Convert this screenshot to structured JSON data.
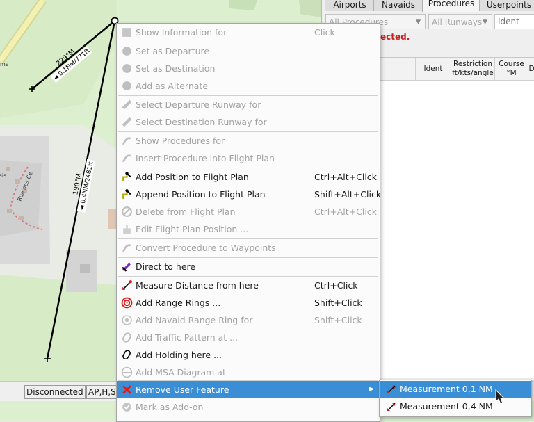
{
  "map": {
    "leg1": {
      "bearing": "229°M",
      "distance": "◄ 0.1NM/771ft"
    },
    "leg2": {
      "bearing": "190°M",
      "distance": "◄ 0.4NM/2481ft"
    },
    "street_label": "Rue des Ce",
    "partial_labels": [
      "ms",
      "ais"
    ]
  },
  "dock": {
    "tabs": [
      "Airports",
      "Navaids",
      "Procedures",
      "Userpoints"
    ],
    "active_tab": "Procedures",
    "filters": {
      "procedures": "All Procedures",
      "runways": "All Runways",
      "ident_placeholder": "Ident"
    },
    "error": "ected.",
    "columns": [
      "tion",
      "Ident",
      "Restriction ft/kts/angle",
      "Course °M",
      "D"
    ]
  },
  "status_bar": {
    "connection": "Disconnected",
    "flags": "AP,H,S,"
  },
  "context_menu": {
    "items": [
      {
        "label": "Show Information for",
        "shortcut": "Click",
        "enabled": false,
        "icon": "info-icon"
      },
      {
        "label": "Set  as Departure",
        "shortcut": "",
        "enabled": false,
        "icon": "airport-icon"
      },
      {
        "label": "Set  as Destination",
        "shortcut": "",
        "enabled": false,
        "icon": "airport-icon"
      },
      {
        "label": "Add  as Alternate",
        "shortcut": "",
        "enabled": false,
        "icon": "airport-icon"
      },
      {
        "label": "Select Departure Runway for",
        "shortcut": "",
        "enabled": false,
        "icon": "runway-icon"
      },
      {
        "label": "Select Destination Runway for",
        "shortcut": "",
        "enabled": false,
        "icon": "runway-icon"
      },
      {
        "label": "Show Procedures for",
        "shortcut": "",
        "enabled": false,
        "icon": "procedure-icon"
      },
      {
        "label": "Insert Procedure  into Flight Plan",
        "shortcut": "",
        "enabled": false,
        "icon": "procedure-icon"
      },
      {
        "label": "Add Position to Flight Plan",
        "shortcut": "Ctrl+Alt+Click",
        "enabled": true,
        "icon": "add-position-icon"
      },
      {
        "label": "Append Position to Flight Plan",
        "shortcut": "Shift+Alt+Click",
        "enabled": true,
        "icon": "append-position-icon"
      },
      {
        "label": "Delete  from Flight Plan",
        "shortcut": "Ctrl+Alt+Click",
        "enabled": false,
        "icon": "delete-icon"
      },
      {
        "label": "Edit Flight Plan Position ...",
        "shortcut": "",
        "enabled": false,
        "icon": "edit-icon"
      },
      {
        "label": "Convert Procedure to Waypoints",
        "shortcut": "",
        "enabled": false,
        "icon": "procedure-icon"
      },
      {
        "label": "Direct to here",
        "shortcut": "",
        "enabled": true,
        "icon": "direct-to-icon"
      },
      {
        "label": "Measure Distance from here",
        "shortcut": "Ctrl+Click",
        "enabled": true,
        "icon": "measure-icon"
      },
      {
        "label": "Add Range Rings ...",
        "shortcut": "Shift+Click",
        "enabled": true,
        "icon": "range-rings-icon"
      },
      {
        "label": "Add Navaid Range Ring for",
        "shortcut": "Shift+Click",
        "enabled": false,
        "icon": "navaid-ring-icon"
      },
      {
        "label": "Add Traffic Pattern at ...",
        "shortcut": "",
        "enabled": false,
        "icon": "traffic-pattern-icon"
      },
      {
        "label": "Add Holding here ...",
        "shortcut": "",
        "enabled": true,
        "icon": "holding-icon"
      },
      {
        "label": "Add MSA Diagram at",
        "shortcut": "",
        "enabled": false,
        "icon": "msa-icon"
      },
      {
        "label": "Remove User Feature",
        "shortcut": "",
        "enabled": true,
        "icon": "remove-icon",
        "highlighted": true,
        "submenu": true
      },
      {
        "label": "Mark  as Add-on",
        "shortcut": "",
        "enabled": false,
        "icon": "addon-icon"
      }
    ]
  },
  "submenu": {
    "items": [
      {
        "label": "Measurement 0,1 NM",
        "highlighted": true
      },
      {
        "label": "Measurement 0,4 NM",
        "highlighted": false
      }
    ]
  },
  "colors": {
    "highlight": "#3a8ed6",
    "error": "#cc1f1f",
    "map_green": "#cfe7bd",
    "map_light": "#eeeee6"
  }
}
